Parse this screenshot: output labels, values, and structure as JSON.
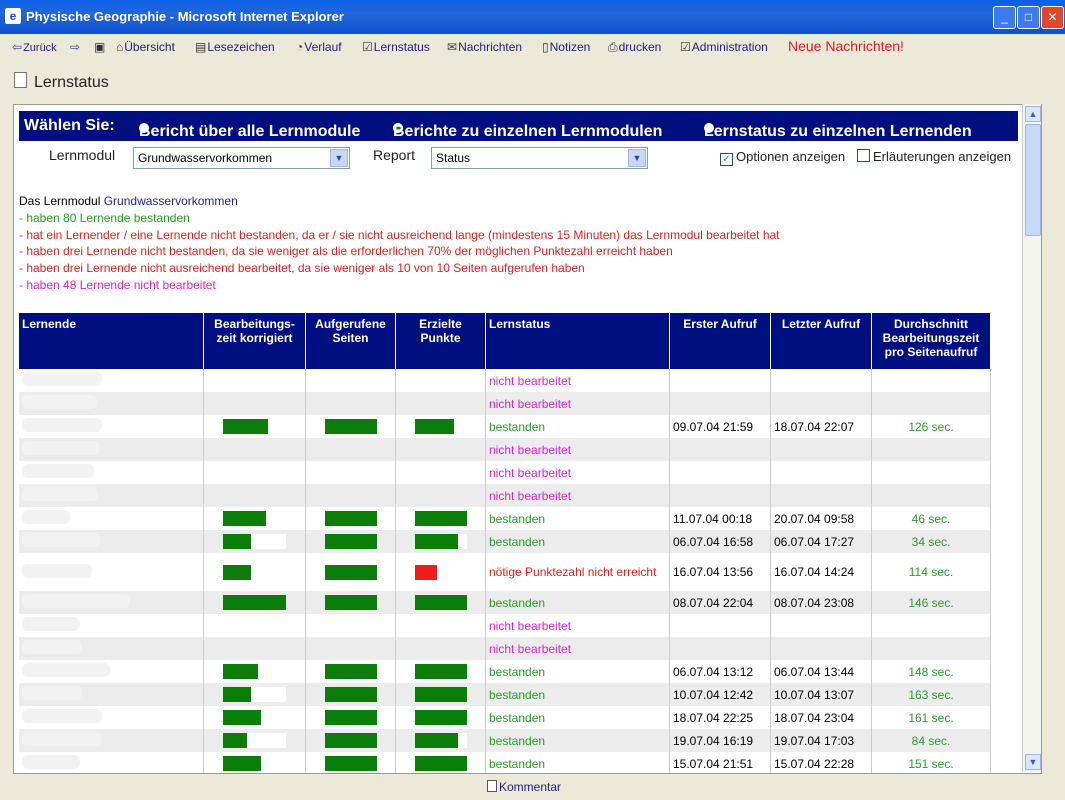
{
  "window": {
    "title": "Physische Geographie - Microsoft Internet Explorer"
  },
  "toolbar": {
    "back": "Zurück",
    "uebersicht": "Übersicht",
    "lesezeichen": "Lesezeichen",
    "verlauf": "Verlauf",
    "lernstatus": "Lernstatus",
    "nachrichten": "Nachrichten",
    "notizen": "Notizen",
    "drucken": "drucken",
    "administration": "Administration",
    "neue_nachrichten": "Neue Nachrichten!"
  },
  "page": {
    "heading": "Lernstatus"
  },
  "selection": {
    "label": "Wählen Sie:",
    "option1": "Bericht über alle Lernmodule",
    "option2": "Berichte zu einzelnen Lernmodulen",
    "option3": "Lernstatus zu einzelnen Lernenden",
    "selected": "option2"
  },
  "form": {
    "lernmodul_label": "Lernmodul",
    "lernmodul_value": "Grundwasservorkommen",
    "report_label": "Report",
    "report_value": "Status",
    "optionen_label": "Optionen anzeigen",
    "optionen_checked": true,
    "erlaeuterungen_label": "Erläuterungen anzeigen",
    "erlaeuterungen_checked": false
  },
  "summary": {
    "intro_prefix": "Das Lernmodul ",
    "module_name": "Grundwasservorkommen",
    "line1": "- haben 80 Lernende bestanden",
    "line2": "- hat ein Lernender / eine Lernende nicht bestanden, da er / sie nicht ausreichend lange (mindestens 15 Minuten) das Lernmodul bearbeitet hat",
    "line3": "- haben drei Lernende nicht bestanden, da sie weniger als die erforderlichen 70% der möglichen Punktezahl erreicht haben",
    "line4": "- haben drei Lernende nicht ausreichend bearbeitet, da sie weniger als 10 von 10 Seiten aufgerufen haben",
    "line5": "- haben 48 Lernende nicht bearbeitet"
  },
  "table": {
    "headers": [
      "Lernende",
      "Bearbeitungs-zeit korrigiert",
      "Aufgerufene Seiten",
      "Erzielte Punkte",
      "Lernstatus",
      "Erster Aufruf",
      "Letzter Aufruf",
      "Durchschnitt Bearbeitungszeit pro Seitenaufruf"
    ],
    "rows": [
      {
        "status": "nicht bearbeitet",
        "status_type": "none",
        "first": "",
        "last": "",
        "avg": ""
      },
      {
        "status": "nicht bearbeitet",
        "status_type": "none",
        "first": "",
        "last": "",
        "avg": ""
      },
      {
        "status": "bestanden",
        "status_type": "pass",
        "time_fill": 0.72,
        "pages_fill": 1.0,
        "points_fill": 0.75,
        "first": "09.07.04 21:59",
        "last": "18.07.04 22:07",
        "avg": "126 sec."
      },
      {
        "status": "nicht bearbeitet",
        "status_type": "none",
        "first": "",
        "last": "",
        "avg": ""
      },
      {
        "status": "nicht bearbeitet",
        "status_type": "none",
        "first": "",
        "last": "",
        "avg": ""
      },
      {
        "status": "nicht bearbeitet",
        "status_type": "none",
        "first": "",
        "last": "",
        "avg": ""
      },
      {
        "status": "bestanden",
        "status_type": "pass",
        "time_fill": 0.68,
        "pages_fill": 1.0,
        "points_fill": 1.0,
        "first": "11.07.04 00:18",
        "last": "20.07.04 09:58",
        "avg": "46 sec."
      },
      {
        "status": "bestanden",
        "status_type": "pass",
        "time_fill": 0.45,
        "pages_fill": 1.0,
        "points_fill": 0.82,
        "first": "06.07.04 16:58",
        "last": "06.07.04 17:27",
        "avg": "34 sec."
      },
      {
        "status": "nötige Punktezahl nicht erreicht",
        "status_type": "fail",
        "time_fill": 0.45,
        "pages_fill": 1.0,
        "points_fill": 0.42,
        "first": "16.07.04 13:56",
        "last": "16.07.04 14:24",
        "avg": "114 sec."
      },
      {
        "status": "bestanden",
        "status_type": "pass",
        "time_fill": 1.0,
        "pages_fill": 1.0,
        "points_fill": 1.0,
        "first": "08.07.04 22:04",
        "last": "08.07.04 23:08",
        "avg": "146 sec."
      },
      {
        "status": "nicht bearbeitet",
        "status_type": "none",
        "first": "",
        "last": "",
        "avg": ""
      },
      {
        "status": "nicht bearbeitet",
        "status_type": "none",
        "first": "",
        "last": "",
        "avg": ""
      },
      {
        "status": "bestanden",
        "status_type": "pass",
        "time_fill": 0.55,
        "pages_fill": 1.0,
        "points_fill": 1.0,
        "first": "06.07.04 13:12",
        "last": "06.07.04 13:44",
        "avg": "148 sec."
      },
      {
        "status": "bestanden",
        "status_type": "pass",
        "time_fill": 0.45,
        "pages_fill": 1.0,
        "points_fill": 1.0,
        "first": "10.07.04 12:42",
        "last": "10.07.04 13:07",
        "avg": "163 sec."
      },
      {
        "status": "bestanden",
        "status_type": "pass",
        "time_fill": 0.6,
        "pages_fill": 1.0,
        "points_fill": 1.0,
        "first": "18.07.04 22:25",
        "last": "18.07.04 23:04",
        "avg": "161 sec."
      },
      {
        "status": "bestanden",
        "status_type": "pass",
        "time_fill": 0.38,
        "pages_fill": 1.0,
        "points_fill": 0.82,
        "first": "19.07.04 16:19",
        "last": "19.07.04 17:03",
        "avg": "84 sec."
      },
      {
        "status": "bestanden",
        "status_type": "pass",
        "time_fill": 0.6,
        "pages_fill": 1.0,
        "points_fill": 1.0,
        "first": "15.07.04 21:51",
        "last": "15.07.04 22:28",
        "avg": "151 sec."
      }
    ]
  },
  "footer": {
    "kommentar": "Kommentar"
  },
  "colors": {
    "header_bg": "#000f80",
    "bar_green": "#0a7d0a",
    "bar_red": "#ee1c1c",
    "status_pass": "#2a9a2a",
    "status_fail": "#e02020",
    "status_none": "#e020d8"
  }
}
